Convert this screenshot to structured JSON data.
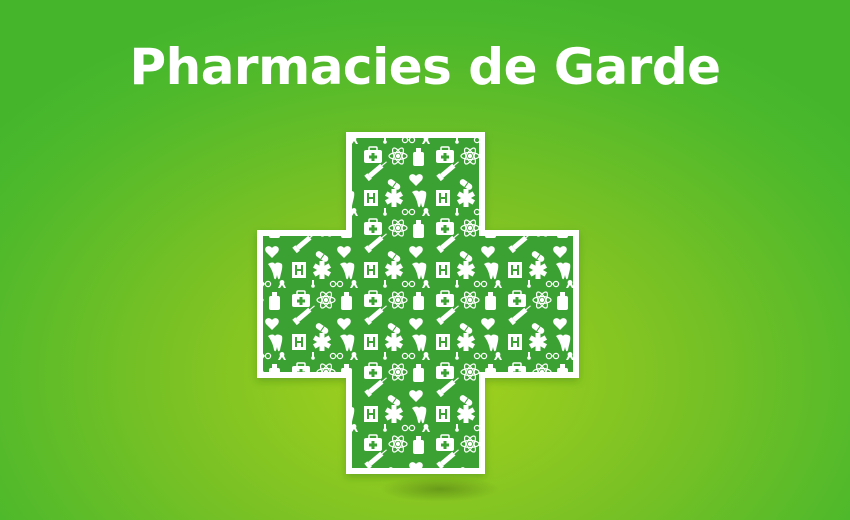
{
  "banner": {
    "title": "Pharmacies de Garde"
  },
  "colors": {
    "background": "#52b92c",
    "background_center": "#a6d31c",
    "cross_fill": "#3aa132",
    "cross_border": "#ffffff",
    "icon_color": "#ffffff"
  },
  "cross": {
    "pattern_icons": [
      "first-aid-kit-icon",
      "atom-icon",
      "bottle-icon",
      "syringe-icon",
      "pill-icon",
      "caduceus-icon",
      "hospital-icon",
      "ambulance-icon",
      "stethoscope-icon",
      "thermometer-icon",
      "heart-icon",
      "tooth-icon",
      "eyeglasses-icon",
      "ribbon-icon",
      "wheelchair-icon",
      "star-of-life-icon"
    ]
  }
}
